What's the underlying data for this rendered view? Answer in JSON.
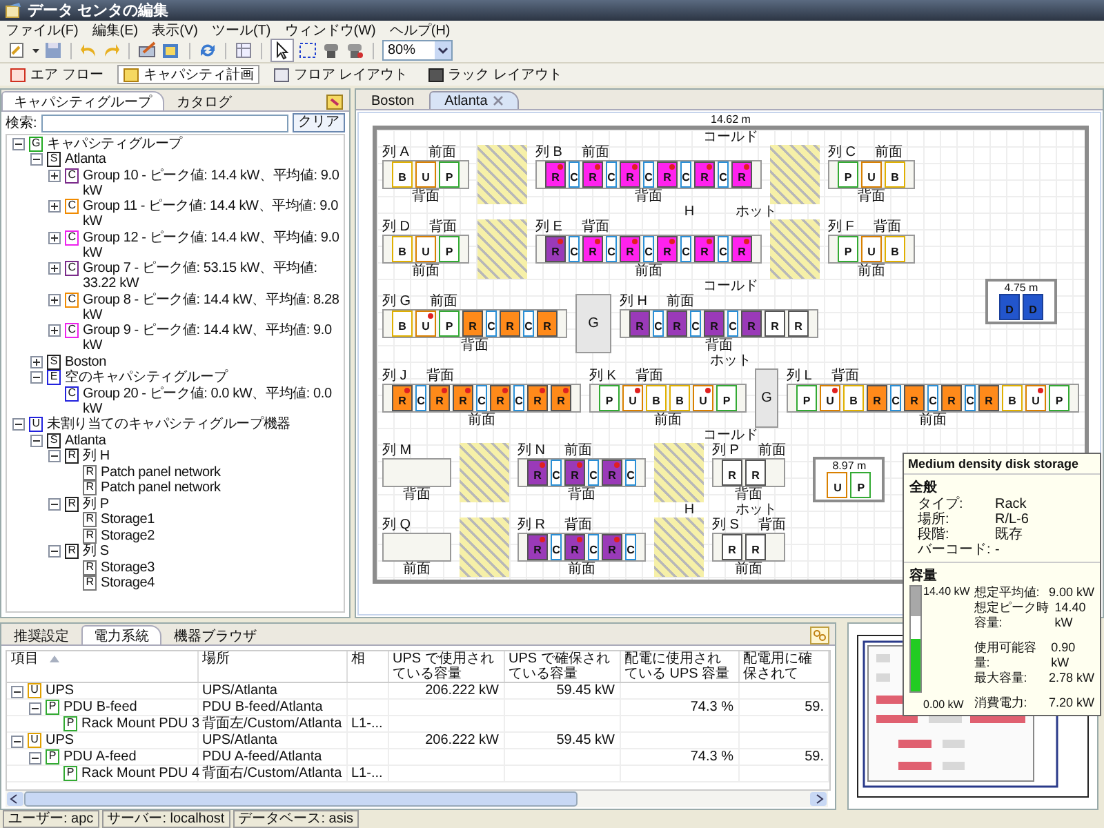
{
  "window": {
    "title": "データ センタの編集"
  },
  "menu": [
    "ファイル(F)",
    "編集(E)",
    "表示(V)",
    "ツール(T)",
    "ウィンドウ(W)",
    "ヘルプ(H)"
  ],
  "toolbar": {
    "zoom": "80%"
  },
  "perspectives": [
    {
      "label": "エア フロー",
      "selected": false
    },
    {
      "label": "キャパシティ計画",
      "selected": true
    },
    {
      "label": "フロア レイアウト",
      "selected": false
    },
    {
      "label": "ラック レイアウト",
      "selected": false
    }
  ],
  "left_panel": {
    "tabs": [
      {
        "label": "キャパシティグループ",
        "selected": true
      },
      {
        "label": "カタログ",
        "selected": false
      }
    ],
    "search": {
      "label": "検索:",
      "button": "クリア"
    },
    "tree": [
      {
        "badge": "G",
        "color": "#22aa22",
        "label": "キャパシティグループ",
        "expanded": true,
        "children": [
          {
            "badge": "S",
            "color": "#222222",
            "label": "Atlanta",
            "expanded": true,
            "children": [
              {
                "badge": "C",
                "color": "#7a2a8a",
                "label": "Group 10 - ピーク値: 14.4 kW、平均値: 9.0 kW",
                "expanded": false
              },
              {
                "badge": "C",
                "color": "#f08a00",
                "label": "Group 11 - ピーク値: 14.4 kW、平均値: 9.0 kW",
                "expanded": false
              },
              {
                "badge": "C",
                "color": "#ee22ee",
                "label": "Group 12 - ピーク値: 14.4 kW、平均値: 9.0 kW",
                "expanded": false
              },
              {
                "badge": "C",
                "color": "#7a2a8a",
                "label": "Group 7 - ピーク値: 53.15 kW、平均値: 33.22 kW",
                "expanded": false
              },
              {
                "badge": "C",
                "color": "#f08a00",
                "label": "Group 8 - ピーク値: 14.4 kW、平均値: 8.28 kW",
                "expanded": false
              },
              {
                "badge": "C",
                "color": "#ee22ee",
                "label": "Group 9 - ピーク値: 14.4 kW、平均値: 9.0 kW",
                "expanded": false
              }
            ]
          },
          {
            "badge": "S",
            "color": "#222222",
            "label": "Boston",
            "expanded": false
          },
          {
            "badge": "E",
            "color": "#2222dd",
            "label": "空のキャパシティグループ",
            "expanded": true,
            "children": [
              {
                "badge": "C",
                "color": "#2222dd",
                "label": "Group 20 - ピーク値: 0.0 kW、平均値: 0.0 kW"
              }
            ]
          }
        ]
      },
      {
        "badge": "U",
        "color": "#2222dd",
        "label": "未割り当てのキャパシティグループ機器",
        "expanded": true,
        "children": [
          {
            "badge": "S",
            "color": "#222222",
            "label": "Atlanta",
            "expanded": true,
            "children": [
              {
                "badge": "R",
                "color": "#222222",
                "label": "列 H",
                "expanded": true,
                "children": [
                  {
                    "badge": "R",
                    "color": "#777777",
                    "label": "Patch panel network"
                  },
                  {
                    "badge": "R",
                    "color": "#777777",
                    "label": "Patch panel network"
                  }
                ]
              },
              {
                "badge": "R",
                "color": "#222222",
                "label": "列 P",
                "expanded": true,
                "children": [
                  {
                    "badge": "R",
                    "color": "#777777",
                    "label": "Storage1"
                  },
                  {
                    "badge": "R",
                    "color": "#777777",
                    "label": "Storage2"
                  }
                ]
              },
              {
                "badge": "R",
                "color": "#222222",
                "label": "列 S",
                "expanded": true,
                "children": [
                  {
                    "badge": "R",
                    "color": "#777777",
                    "label": "Storage3"
                  },
                  {
                    "badge": "R",
                    "color": "#777777",
                    "label": "Storage4"
                  }
                ]
              }
            ]
          }
        ]
      }
    ]
  },
  "editor_tabs": [
    {
      "label": "Boston",
      "selected": false,
      "closable": false
    },
    {
      "label": "Atlanta",
      "selected": true,
      "closable": true
    }
  ],
  "floor_plan": {
    "dimension": "14.62 m",
    "bands": [
      {
        "kind": "aisle",
        "label": "コールド"
      },
      {
        "kind": "racks",
        "groups": [
          {
            "kind": "row",
            "name": "列 A",
            "top": "前面",
            "bottom": "背面",
            "racks": [
              {
                "letter": "B",
                "kind": "battery",
                "color": "#ffffff",
                "alert": false
              },
              {
                "letter": "U",
                "kind": "ups",
                "color": "#ffffff",
                "alert": false
              },
              {
                "letter": "P",
                "kind": "pdu",
                "color": "#ffffff",
                "alert": false
              }
            ]
          },
          {
            "kind": "hatch"
          },
          {
            "kind": "row",
            "name": "列 B",
            "top": "前面",
            "bottom": "背面",
            "racks": [
              {
                "letter": "R",
                "kind": "rack",
                "color": "#ff22ee",
                "alert": true
              },
              {
                "letter": "C",
                "kind": "cooling",
                "color": "#ffffff",
                "alert": false
              },
              {
                "letter": "R",
                "kind": "rack",
                "color": "#ff22ee",
                "alert": true
              },
              {
                "letter": "C",
                "kind": "cooling",
                "color": "#ffffff",
                "alert": false
              },
              {
                "letter": "R",
                "kind": "rack",
                "color": "#ff22ee",
                "alert": true
              },
              {
                "letter": "C",
                "kind": "cooling",
                "color": "#ffffff",
                "alert": false
              },
              {
                "letter": "R",
                "kind": "rack",
                "color": "#ff22ee",
                "alert": true
              },
              {
                "letter": "C",
                "kind": "cooling",
                "color": "#ffffff",
                "alert": false
              },
              {
                "letter": "R",
                "kind": "rack",
                "color": "#ff22ee",
                "alert": true
              },
              {
                "letter": "C",
                "kind": "cooling",
                "color": "#ffffff",
                "alert": false
              },
              {
                "letter": "R",
                "kind": "rack",
                "color": "#ff22ee",
                "alert": true
              }
            ]
          },
          {
            "kind": "hatch"
          },
          {
            "kind": "row",
            "name": "列 C",
            "top": "前面",
            "bottom": "背面",
            "racks": [
              {
                "letter": "P",
                "kind": "pdu",
                "color": "#ffffff",
                "alert": false
              },
              {
                "letter": "U",
                "kind": "ups",
                "color": "#ffffff",
                "alert": false
              },
              {
                "letter": "B",
                "kind": "battery",
                "color": "#ffffff",
                "alert": false
              }
            ]
          }
        ]
      },
      {
        "kind": "aisle",
        "marker": "H",
        "label": "ホット"
      },
      {
        "kind": "racks",
        "groups": [
          {
            "kind": "row",
            "name": "列 D",
            "top": "背面",
            "bottom": "前面",
            "racks": [
              {
                "letter": "B",
                "kind": "battery",
                "color": "#ffffff",
                "alert": false
              },
              {
                "letter": "U",
                "kind": "ups",
                "color": "#ffffff",
                "alert": false
              },
              {
                "letter": "P",
                "kind": "pdu",
                "color": "#ffffff",
                "alert": false
              }
            ]
          },
          {
            "kind": "hatch"
          },
          {
            "kind": "row",
            "name": "列 E",
            "top": "背面",
            "bottom": "前面",
            "racks": [
              {
                "letter": "R",
                "kind": "rack",
                "color": "#9a3ab8",
                "alert": true
              },
              {
                "letter": "C",
                "kind": "cooling",
                "color": "#ffffff",
                "alert": false
              },
              {
                "letter": "R",
                "kind": "rack",
                "color": "#ff22ee",
                "alert": true
              },
              {
                "letter": "C",
                "kind": "cooling",
                "color": "#ffffff",
                "alert": false
              },
              {
                "letter": "R",
                "kind": "rack",
                "color": "#ff22ee",
                "alert": true
              },
              {
                "letter": "C",
                "kind": "cooling",
                "color": "#ffffff",
                "alert": false
              },
              {
                "letter": "R",
                "kind": "rack",
                "color": "#ff22ee",
                "alert": true
              },
              {
                "letter": "C",
                "kind": "cooling",
                "color": "#ffffff",
                "alert": false
              },
              {
                "letter": "R",
                "kind": "rack",
                "color": "#ff22ee",
                "alert": true
              },
              {
                "letter": "C",
                "kind": "cooling",
                "color": "#ffffff",
                "alert": false
              },
              {
                "letter": "R",
                "kind": "rack",
                "color": "#ff22ee",
                "alert": true
              }
            ]
          },
          {
            "kind": "hatch"
          },
          {
            "kind": "row",
            "name": "列 F",
            "top": "背面",
            "bottom": "前面",
            "racks": [
              {
                "letter": "P",
                "kind": "pdu",
                "color": "#ffffff",
                "alert": false
              },
              {
                "letter": "U",
                "kind": "ups",
                "color": "#ffffff",
                "alert": false
              },
              {
                "letter": "B",
                "kind": "battery",
                "color": "#ffffff",
                "alert": false
              }
            ]
          }
        ]
      },
      {
        "kind": "aisle",
        "label": "コールド",
        "room": {
          "label": "4.75 m",
          "racks": [
            {
              "letter": "D",
              "kind": "device",
              "color": "#2255cc",
              "alert": false
            },
            {
              "letter": "D",
              "kind": "device",
              "color": "#2255cc",
              "alert": false
            }
          ]
        }
      },
      {
        "kind": "racks",
        "groups": [
          {
            "kind": "row",
            "name": "列 G",
            "top": "前面",
            "bottom": "背面",
            "racks": [
              {
                "letter": "B",
                "kind": "battery",
                "color": "#ffffff",
                "alert": false
              },
              {
                "letter": "U",
                "kind": "ups",
                "color": "#ffffff",
                "alert": true
              },
              {
                "letter": "P",
                "kind": "pdu",
                "color": "#ffffff",
                "alert": false
              },
              {
                "letter": "R",
                "kind": "rack",
                "color": "#ff8a1a",
                "alert": false
              },
              {
                "letter": "C",
                "kind": "cooling",
                "color": "#ffffff",
                "alert": false
              },
              {
                "letter": "R",
                "kind": "rack",
                "color": "#ff8a1a",
                "alert": false
              },
              {
                "letter": "C",
                "kind": "cooling",
                "color": "#ffffff",
                "alert": false
              },
              {
                "letter": "R",
                "kind": "rack",
                "color": "#ff8a1a",
                "alert": false
              }
            ]
          },
          {
            "kind": "block",
            "label": "G"
          },
          {
            "kind": "row",
            "name": "列 H",
            "top": "前面",
            "bottom": "背面",
            "racks": [
              {
                "letter": "R",
                "kind": "rack",
                "color": "#9a3ab8",
                "alert": false
              },
              {
                "letter": "C",
                "kind": "cooling",
                "color": "#ffffff",
                "alert": false
              },
              {
                "letter": "R",
                "kind": "rack",
                "color": "#9a3ab8",
                "alert": false
              },
              {
                "letter": "C",
                "kind": "cooling",
                "color": "#ffffff",
                "alert": false
              },
              {
                "letter": "R",
                "kind": "rack",
                "color": "#9a3ab8",
                "alert": false
              },
              {
                "letter": "C",
                "kind": "cooling",
                "color": "#ffffff",
                "alert": false
              },
              {
                "letter": "R",
                "kind": "rack",
                "color": "#9a3ab8",
                "alert": false
              },
              {
                "letter": "R",
                "kind": "rack",
                "color": "#ffffff",
                "alert": false
              },
              {
                "letter": "R",
                "kind": "rack",
                "color": "#ffffff",
                "alert": false
              }
            ]
          }
        ]
      },
      {
        "kind": "aisle",
        "label": "ホット"
      },
      {
        "kind": "racks",
        "groups": [
          {
            "kind": "row",
            "name": "列 J",
            "top": "背面",
            "bottom": "前面",
            "racks": [
              {
                "letter": "R",
                "kind": "rack",
                "color": "#ff8a1a",
                "alert": true
              },
              {
                "letter": "C",
                "kind": "cooling",
                "color": "#ffffff",
                "alert": false
              },
              {
                "letter": "R",
                "kind": "rack",
                "color": "#ff8a1a",
                "alert": true
              },
              {
                "letter": "R",
                "kind": "rack",
                "color": "#ff8a1a",
                "alert": true
              },
              {
                "letter": "C",
                "kind": "cooling",
                "color": "#ffffff",
                "alert": false
              },
              {
                "letter": "R",
                "kind": "rack",
                "color": "#ff8a1a",
                "alert": true
              },
              {
                "letter": "C",
                "kind": "cooling",
                "color": "#ffffff",
                "alert": false
              },
              {
                "letter": "R",
                "kind": "rack",
                "color": "#ff8a1a",
                "alert": true
              },
              {
                "letter": "R",
                "kind": "rack",
                "color": "#ff8a1a",
                "alert": true
              }
            ]
          },
          {
            "kind": "row",
            "name": "列 K",
            "top": "背面",
            "bottom": "前面",
            "racks": [
              {
                "letter": "P",
                "kind": "pdu",
                "color": "#ffffff",
                "alert": false
              },
              {
                "letter": "U",
                "kind": "ups",
                "color": "#ffffff",
                "alert": true
              },
              {
                "letter": "B",
                "kind": "battery",
                "color": "#ffffff",
                "alert": false
              },
              {
                "letter": "B",
                "kind": "battery",
                "color": "#ffffff",
                "alert": false
              },
              {
                "letter": "U",
                "kind": "ups",
                "color": "#ffffff",
                "alert": true
              },
              {
                "letter": "P",
                "kind": "pdu",
                "color": "#ffffff",
                "alert": false
              }
            ]
          },
          {
            "kind": "block",
            "label": "G"
          },
          {
            "kind": "row",
            "name": "列 L",
            "top": "背面",
            "bottom": "前面",
            "racks": [
              {
                "letter": "P",
                "kind": "pdu",
                "color": "#ffffff",
                "alert": false
              },
              {
                "letter": "U",
                "kind": "ups",
                "color": "#ffffff",
                "alert": true
              },
              {
                "letter": "B",
                "kind": "battery",
                "color": "#ffffff",
                "alert": false
              },
              {
                "letter": "R",
                "kind": "rack",
                "color": "#ff8a1a",
                "alert": false
              },
              {
                "letter": "C",
                "kind": "cooling",
                "color": "#ffffff",
                "alert": false
              },
              {
                "letter": "R",
                "kind": "rack",
                "color": "#ff8a1a",
                "alert": false
              },
              {
                "letter": "C",
                "kind": "cooling",
                "color": "#ffffff",
                "alert": false
              },
              {
                "letter": "R",
                "kind": "rack",
                "color": "#ff8a1a",
                "alert": false
              },
              {
                "letter": "C",
                "kind": "cooling",
                "color": "#ffffff",
                "alert": false
              },
              {
                "letter": "R",
                "kind": "rack",
                "color": "#ff8a1a",
                "alert": false
              },
              {
                "letter": "B",
                "kind": "battery",
                "color": "#ffffff",
                "alert": false
              },
              {
                "letter": "U",
                "kind": "ups",
                "color": "#ffffff",
                "alert": true
              },
              {
                "letter": "P",
                "kind": "pdu",
                "color": "#ffffff",
                "alert": false
              }
            ]
          }
        ]
      },
      {
        "kind": "aisle",
        "label": "コールド"
      },
      {
        "kind": "racks",
        "groups": [
          {
            "kind": "row",
            "name": "列 M",
            "bottom": "背面"
          },
          {
            "kind": "hatch"
          },
          {
            "kind": "row",
            "name": "列 N",
            "top": "前面",
            "bottom": "背面",
            "racks": [
              {
                "letter": "R",
                "kind": "rack",
                "color": "#9a3ab8",
                "alert": true
              },
              {
                "letter": "C",
                "kind": "cooling",
                "color": "#ffffff",
                "alert": false
              },
              {
                "letter": "R",
                "kind": "rack",
                "color": "#9a3ab8",
                "alert": true
              },
              {
                "letter": "C",
                "kind": "cooling",
                "color": "#ffffff",
                "alert": false
              },
              {
                "letter": "R",
                "kind": "rack",
                "color": "#9a3ab8",
                "alert": true
              },
              {
                "letter": "C",
                "kind": "cooling",
                "color": "#ffffff",
                "alert": false
              }
            ]
          },
          {
            "kind": "hatch"
          },
          {
            "kind": "row",
            "name": "列 P",
            "top": "前面",
            "bottom": "背面",
            "racks": [
              {
                "letter": "R",
                "kind": "rack",
                "color": "#ffffff",
                "alert": false
              },
              {
                "letter": "R",
                "kind": "rack",
                "color": "#ffffff",
                "alert": false
              }
            ]
          },
          {
            "kind": "room",
            "label": "8.97 m",
            "racks": [
              {
                "letter": "U",
                "kind": "ups",
                "color": "#ffffff",
                "alert": false
              },
              {
                "letter": "P",
                "kind": "pdu",
                "color": "#ffffff",
                "alert": false
              }
            ]
          }
        ]
      },
      {
        "kind": "aisle",
        "marker": "H",
        "label": "ホット"
      },
      {
        "kind": "racks",
        "groups": [
          {
            "kind": "row",
            "name": "列 Q",
            "bottom": "前面"
          },
          {
            "kind": "hatch"
          },
          {
            "kind": "row",
            "name": "列 R",
            "top": "背面",
            "bottom": "前面",
            "racks": [
              {
                "letter": "R",
                "kind": "rack",
                "color": "#9a3ab8",
                "alert": true
              },
              {
                "letter": "C",
                "kind": "cooling",
                "color": "#ffffff",
                "alert": false
              },
              {
                "letter": "R",
                "kind": "rack",
                "color": "#9a3ab8",
                "alert": true
              },
              {
                "letter": "C",
                "kind": "cooling",
                "color": "#ffffff",
                "alert": false
              },
              {
                "letter": "R",
                "kind": "rack",
                "color": "#9a3ab8",
                "alert": true
              },
              {
                "letter": "C",
                "kind": "cooling",
                "color": "#ffffff",
                "alert": false
              }
            ]
          },
          {
            "kind": "hatch"
          },
          {
            "kind": "row",
            "name": "列 S",
            "top": "背面",
            "bottom": "前面",
            "racks": [
              {
                "letter": "R",
                "kind": "rack",
                "color": "#ffffff",
                "alert": false
              },
              {
                "letter": "R",
                "kind": "rack",
                "color": "#ffffff",
                "alert": false
              }
            ]
          }
        ]
      }
    ]
  },
  "tooltip": {
    "title": "Medium density disk storage",
    "general": {
      "heading": "全般",
      "fields": [
        {
          "label": "タイプ:",
          "value": "Rack"
        },
        {
          "label": "場所:",
          "value": "R/L-6"
        },
        {
          "label": "段階:",
          "value": "既存"
        },
        {
          "label": "バーコード:",
          "value": "-"
        }
      ]
    },
    "capacity": {
      "heading": "容量",
      "gauge": {
        "max": "14.40 kW",
        "min": "0.00 kW",
        "level": 0.5
      },
      "groups": [
        [
          {
            "label": "想定平均値:",
            "value": "9.00 kW"
          },
          {
            "label": "想定ピーク時容量:",
            "value": "14.40 kW"
          }
        ],
        [
          {
            "label": "使用可能容量:",
            "value": "0.90 kW"
          },
          {
            "label": "最大容量:",
            "value": "2.78 kW"
          }
        ],
        [
          {
            "label": "消費電力:",
            "value": "7.20 kW"
          }
        ]
      ]
    }
  },
  "bottom_panel": {
    "tabs": [
      {
        "label": "推奨設定",
        "selected": false
      },
      {
        "label": "電力系統",
        "selected": true
      },
      {
        "label": "機器ブラウザ",
        "selected": false
      }
    ],
    "table": {
      "columns": [
        {
          "label": "項目",
          "sorted": true
        },
        {
          "label": "場所",
          "sorted": false
        },
        {
          "label": "相",
          "sorted": false
        },
        {
          "label": "UPS で使用されている容量",
          "sorted": false
        },
        {
          "label": "UPS で確保されている容量",
          "sorted": false
        },
        {
          "label": "配電に使用されている UPS 容量",
          "sorted": false
        },
        {
          "label": "配電用に確保されて",
          "sorted": false
        }
      ],
      "rows": [
        {
          "badge": "U",
          "color": "#e0a000",
          "expanded": true,
          "cells": {
            "item": "UPS",
            "location": "UPS/Atlanta",
            "ups_used": "206.222 kW",
            "ups_reserved": "59.45 kW"
          },
          "children": [
            {
              "badge": "P",
              "color": "#33aa33",
              "expanded": true,
              "cells": {
                "item": "PDU B-feed",
                "location": "PDU B-feed/Atlanta",
                "dist_used": "74.3 %",
                "dist_reserved": "59."
              },
              "children": [
                {
                  "badge": "P",
                  "color": "#33aa33",
                  "cells": {
                    "item": "Rack Mount PDU 3",
                    "location": "背面左/Custom/Atlanta",
                    "phase": "L1-..."
                  }
                }
              ]
            }
          ]
        },
        {
          "badge": "U",
          "color": "#e0a000",
          "expanded": true,
          "cells": {
            "item": "UPS",
            "location": "UPS/Atlanta",
            "ups_used": "206.222 kW",
            "ups_reserved": "59.45 kW"
          },
          "children": [
            {
              "badge": "P",
              "color": "#33aa33",
              "expanded": true,
              "cells": {
                "item": "PDU A-feed",
                "location": "PDU A-feed/Atlanta",
                "dist_used": "74.3 %",
                "dist_reserved": "59."
              },
              "children": [
                {
                  "badge": "P",
                  "color": "#33aa33",
                  "cells": {
                    "item": "Rack Mount PDU 4",
                    "location": "背面右/Custom/Atlanta",
                    "phase": "L1-..."
                  }
                }
              ]
            }
          ]
        }
      ]
    }
  },
  "status_bar": [
    "ユーザー: apc",
    "サーバー: localhost",
    "データベース: asis"
  ]
}
